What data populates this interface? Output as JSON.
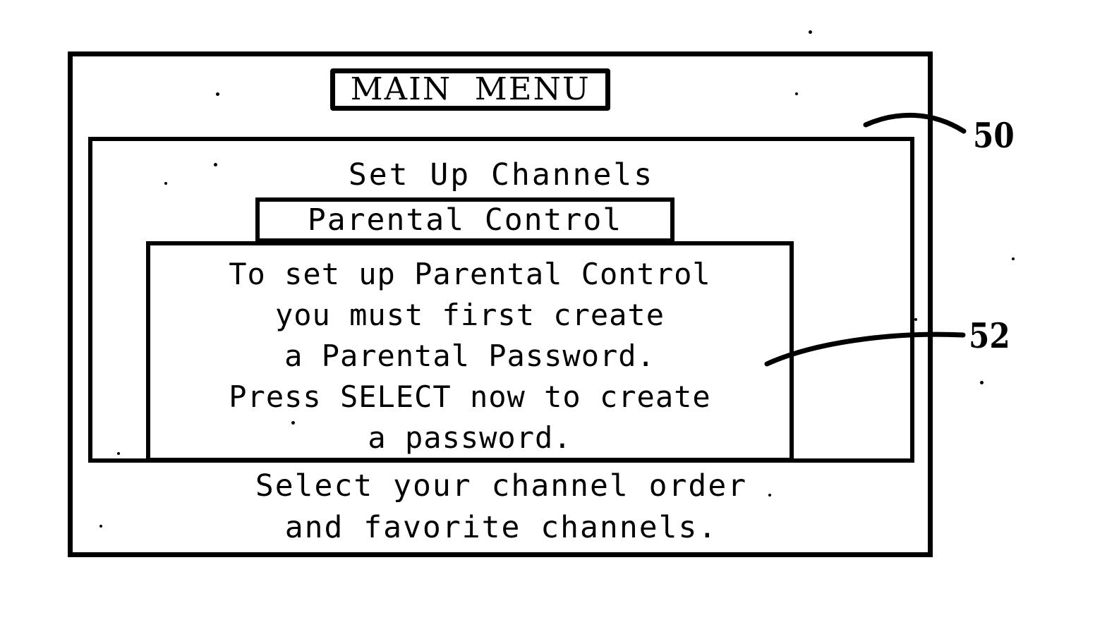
{
  "figure": {
    "title_box": {
      "label": "MAIN  MENU"
    },
    "menu_panel": {
      "item_setup_channels": "Set Up Channels",
      "item_parental_control": "Parental Control",
      "description_line_1": "Select your channel order",
      "description_line_2": "and favorite channels."
    },
    "dialog": {
      "line_1": "To set up Parental Control",
      "line_2": "you must first create",
      "line_3": "a Parental Password.",
      "line_4": "Press SELECT now to create",
      "line_5": "a password."
    },
    "reference_numerals": {
      "screen": "50",
      "dialog": "52"
    },
    "colors": {
      "ink": "#000000",
      "background": "#ffffff"
    }
  }
}
